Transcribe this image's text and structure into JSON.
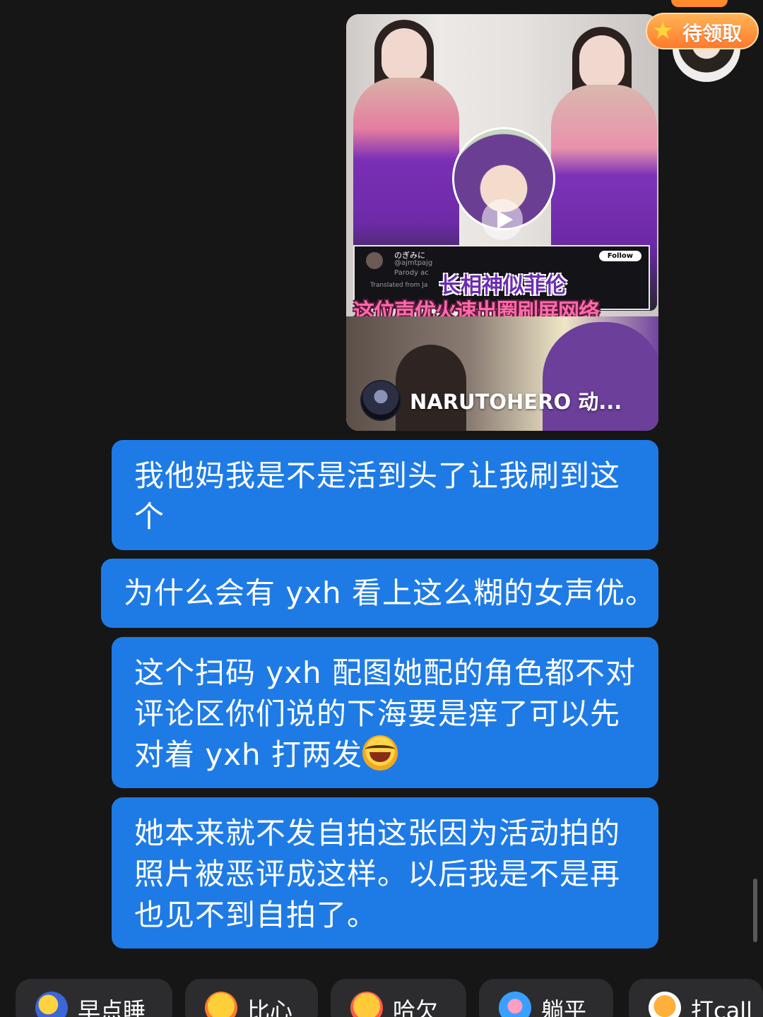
{
  "shared_video": {
    "tweet": {
      "name": "のぎみに",
      "handle": "@ajmtpajg",
      "parody": "Parody ac",
      "translated": "Translated from Ja",
      "follow_label": "Follow"
    },
    "headline_1": "长相神似菲伦",
    "headline_2": "这位声优火速出圈刷屏网络",
    "author": "NARUTOHERO 动..."
  },
  "reward": {
    "label": "待领取"
  },
  "messages": [
    {
      "text": "我他妈我是不是活到头了让我刷到这个"
    },
    {
      "text": "为什么会有 yxh 看上这么糊的女声优。"
    },
    {
      "text": "这个扫码 yxh 配图她配的角色都不对评论区你们说的下海要是痒了可以先对着 yxh 打两发"
    },
    {
      "text": "她本来就不发自拍这张因为活动拍的照片被恶评成这样。以后我是不是再也见不到自拍了。"
    }
  ],
  "quick_replies": [
    {
      "label": "早点睡",
      "icon": "sleep-emoji-icon"
    },
    {
      "label": "比心",
      "icon": "heart-hands-emoji-icon"
    },
    {
      "label": "哈欠",
      "icon": "yawn-emoji-icon"
    },
    {
      "label": "躺平",
      "icon": "lie-flat-emoji-icon"
    },
    {
      "label": "打call",
      "icon": "cheer-emoji-icon"
    }
  ],
  "colors": {
    "background": "#161616",
    "bubble": "#1e7be6",
    "chip": "#2c2c2e",
    "reward": "#ff7a2b"
  }
}
